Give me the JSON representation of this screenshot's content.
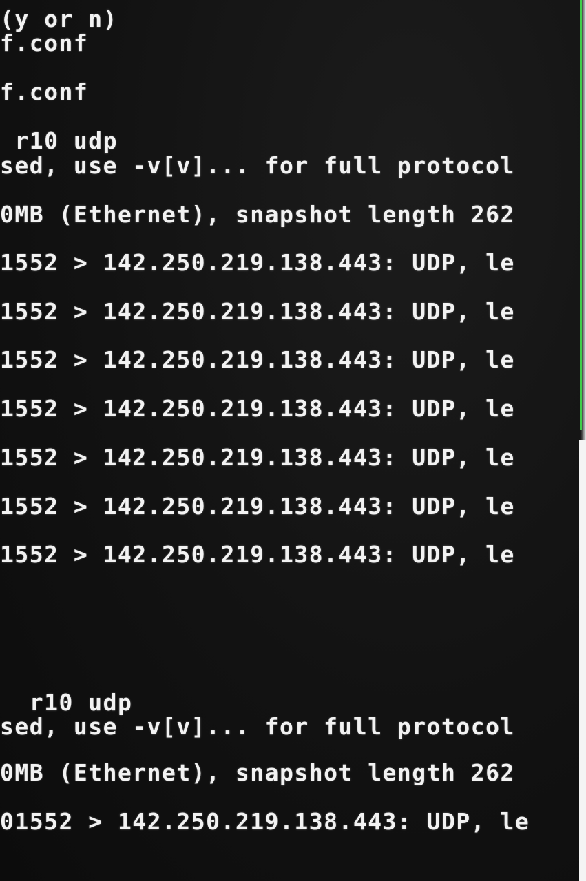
{
  "terminal": {
    "lines": [
      "(y or n)",
      "f.conf",
      "f.conf",
      " r10 udp",
      "sed, use -v[v]... for full protocol",
      "0MB (Ethernet), snapshot length 262",
      "1552 > 142.250.219.138.443: UDP, le",
      "1552 > 142.250.219.138.443: UDP, le",
      "1552 > 142.250.219.138.443: UDP, le",
      "1552 > 142.250.219.138.443: UDP, le",
      "1552 > 142.250.219.138.443: UDP, le",
      "1552 > 142.250.219.138.443: UDP, le",
      "1552 > 142.250.219.138.443: UDP, le",
      "  r10 udp",
      "sed, use -v[v]... for full protocol",
      "0MB (Ethernet), snapshot length 262",
      "01552 > 142.250.219.138.443: UDP, le"
    ]
  },
  "colors": {
    "background": "#121212",
    "text": "#f2f2f2",
    "accent_border": "#3fd04a"
  }
}
